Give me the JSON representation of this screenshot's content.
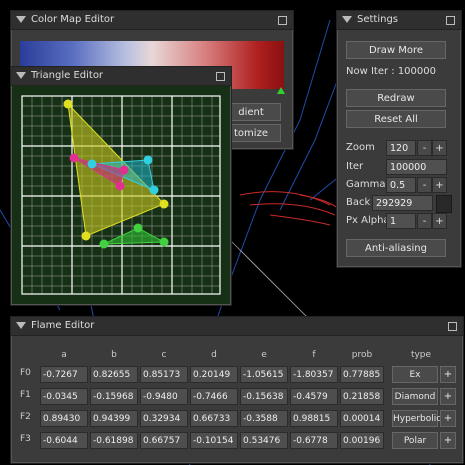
{
  "color_map_editor": {
    "title": "Color Map Editor",
    "button_1": "dient",
    "button_2": "tomize"
  },
  "triangle_editor": {
    "title": "Triangle Editor"
  },
  "settings": {
    "title": "Settings",
    "draw_more": "Draw More",
    "status": "Now Iter : 100000",
    "redraw": "Redraw",
    "reset_all": "Reset All",
    "zoom_label": "Zoom",
    "zoom_value": "120",
    "iter_label": "Iter",
    "iter_value": "100000",
    "gamma_label": "Gamma",
    "gamma_value": "0.5",
    "back_label": "Back",
    "back_value": "292929",
    "alpha_label": "Px Alpha",
    "alpha_value": "1",
    "anti_aliasing": "Anti-aliasing",
    "minus": "-",
    "plus": "+",
    "back_color": "#292929"
  },
  "flame_editor": {
    "title": "Flame Editor",
    "columns": [
      "a",
      "b",
      "c",
      "d",
      "e",
      "f",
      "prob",
      "type"
    ],
    "rows": [
      {
        "label": "F0",
        "values": [
          "-0.7267",
          "0.82655",
          "0.85173",
          "0.20149",
          "-1.05615",
          "-1.80357",
          "0.77885"
        ],
        "type": "Ex"
      },
      {
        "label": "F1",
        "values": [
          "-0.0345",
          "-0.15968",
          "-0.9480",
          "-0.7466",
          "-0.15638",
          "-0.4579",
          "0.21858"
        ],
        "type": "Diamond"
      },
      {
        "label": "F2",
        "values": [
          "0.89430",
          "0.94399",
          "0.32934",
          "0.66733",
          "-0.3588",
          "0.98815",
          "0.00014"
        ],
        "type": "Hyperbolic"
      },
      {
        "label": "F3",
        "values": [
          "-0.6044",
          "-0.61898",
          "0.66757",
          "-0.10154",
          "0.53476",
          "-0.6778",
          "0.00196"
        ],
        "type": "Polar"
      }
    ],
    "plus": "+"
  }
}
